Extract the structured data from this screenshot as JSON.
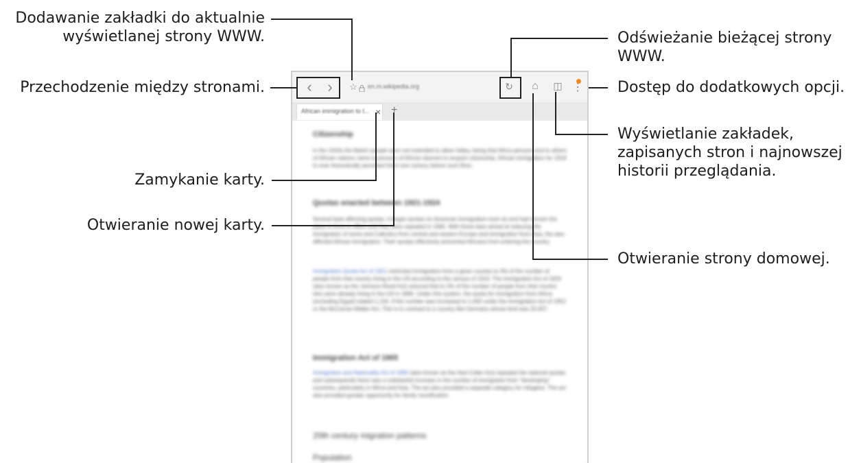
{
  "callouts": {
    "bookmark": [
      "Dodawanie zakładki do aktualnie",
      "wyświetlanej strony WWW."
    ],
    "nav": "Przechodzenie między stronami.",
    "close_tab": "Zamykanie karty.",
    "new_tab": "Otwieranie nowej karty.",
    "refresh": [
      "Odświeżanie bieżącej strony",
      "WWW."
    ],
    "more_options": "Dostęp do dodatkowych opcji.",
    "bookmarks_view": [
      "Wyświetlanie zakładek,",
      "zapisanych stron i najnowszej",
      "historii przeglądania."
    ],
    "home": "Otwieranie strony domowej."
  },
  "browser": {
    "url": "en.m.wikipedia.org",
    "tab_title": "African immigration to t...",
    "icons": {
      "back": "chevron-left-icon",
      "forward": "chevron-right-icon",
      "bookmark": "star-icon",
      "lock": "lock-icon",
      "refresh": "refresh-icon",
      "home": "home-icon",
      "bookmarks": "book-icon",
      "more": "more-vert-icon",
      "close_tab": "close-icon",
      "new_tab": "plus-icon"
    },
    "glyphs": {
      "back": "‹",
      "forward": "›",
      "bookmark": "☆",
      "lock": "🔒",
      "refresh": "↻",
      "home": "⌂",
      "bookmarks": "◫",
      "more": "⋮",
      "close_tab": "×",
      "new_tab": "+"
    }
  },
  "article": {
    "sections": [
      {
        "heading": "Citizenship",
        "text": "In the 1910s the Bahá'í people were not extended to allow Valley, being that Africa persons and to others of African nations came to persons of African descent to acquire citizenship. African immigration for 1918 to ever theoretically permitted them one century before such Brac."
      },
      {
        "heading": "Quotas enacted between 1921-1924",
        "text": "Several laws affecting quotas, it began quotas on American immigration even as and had chosen the place in force in office until they were repealed in 1965. With these laws aimed at reducing the immigration of some and Catholics from central and eastern Europe and immigration from Asia, the also affected African immigration. Their quotas effectively prevented Africans from entering the country."
      },
      {
        "heading": "",
        "link": "Immigration Quota Act of 1921",
        "text": "restricted immigration from a given country to 3% of the number of people from that country living in the US according to the census of 1910. The Immigration Act of 1924 (also known as the Johnson-Reed Act) reduced that to 2% of the number of people from that country who were already living in the US in 1890. Under this system, the quota for immigration from Africa (excluding Egypt) totaled 1,100. If the number was increased to 1,400 under the Immigration Act of 1952 or the McCarran-Walter Act. This is in contrast to a country like Germany whose limit was 25,957."
      },
      {
        "heading": "Immigration Act of 1965",
        "link": "Immigration and Nationality Act of 1965",
        "text": "(also known as the Hart-Celler Act) repealed the national quotas and subsequently there was a substantial increase in the number of immigrants from \"developing\" countries, particularly in Africa and Asia. The act also provided a separate category for refugees. The act also provided greater opportunity for family reunification."
      }
    ],
    "collapsed": [
      "20th century migration patterns",
      "Population"
    ]
  }
}
